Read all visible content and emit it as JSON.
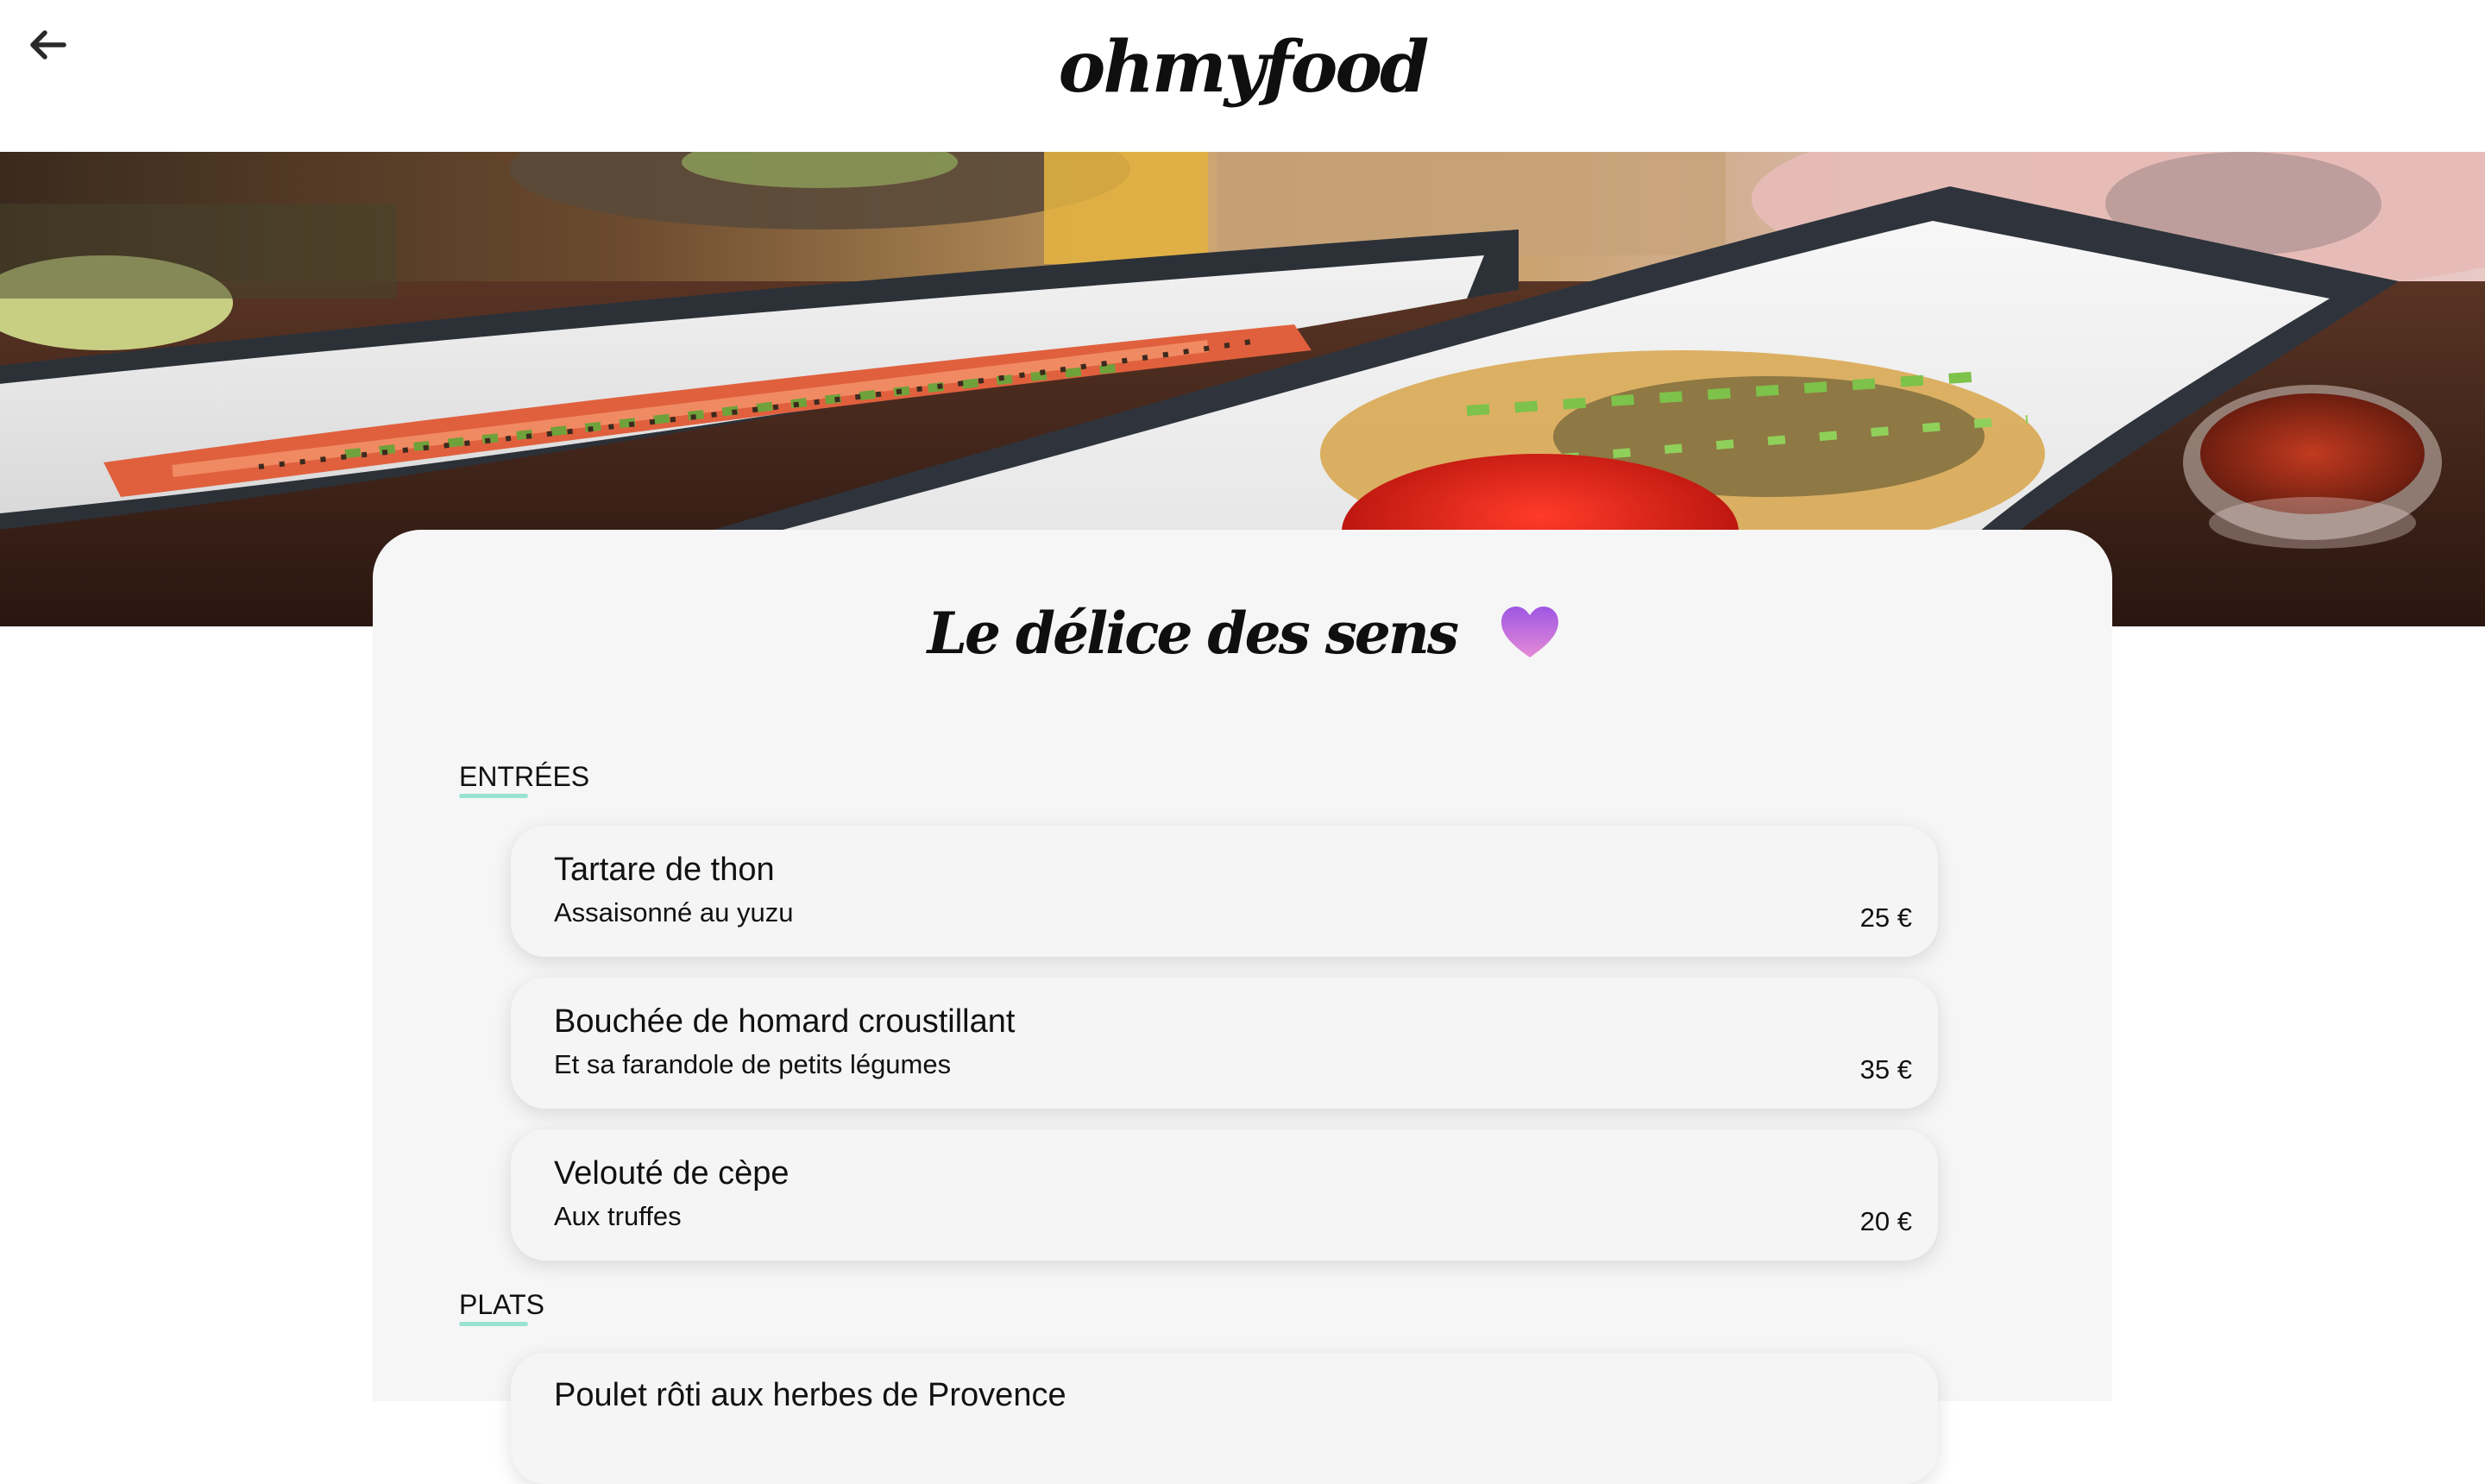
{
  "header": {
    "back_icon": "arrow-left-icon",
    "logo": "ohmyfood"
  },
  "hero": {
    "image_icon": "food-photo"
  },
  "restaurant": {
    "name": "Le délice des sens",
    "favorite_icon": "heart-icon",
    "favorite_color": "#b66ee0"
  },
  "accent_color": "#99e2d0",
  "sections": [
    {
      "title": "ENTRÉES",
      "dishes": [
        {
          "name": "Tartare de thon",
          "description": "Assaisonné au yuzu",
          "price": "25 €"
        },
        {
          "name": "Bouchée de homard croustillant",
          "description": "Et sa farandole de petits légumes",
          "price": "35 €"
        },
        {
          "name": "Velouté de cèpe",
          "description": "Aux truffes",
          "price": "20 €"
        }
      ]
    },
    {
      "title": "PLATS",
      "dishes": [
        {
          "name": "Poulet rôti aux herbes de Provence",
          "description": "",
          "price": ""
        }
      ]
    }
  ]
}
